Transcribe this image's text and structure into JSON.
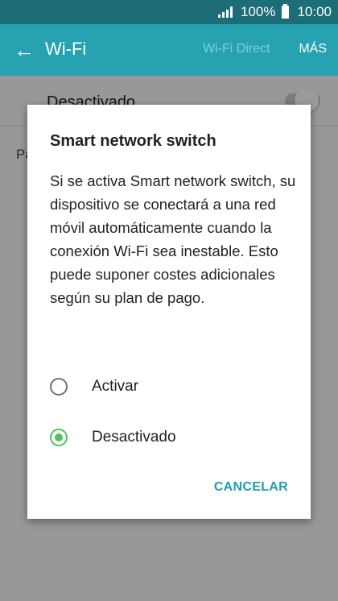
{
  "status_bar": {
    "battery_percent": "100%",
    "time": "10:00"
  },
  "app_bar": {
    "title": "Wi-Fi",
    "wifi_direct_label": "Wi-Fi Direct",
    "more_label": "MÁS"
  },
  "background_list": {
    "toggle_label": "Desactivado",
    "toggle_state": "off",
    "partial_text": "Pa"
  },
  "dialog": {
    "title": "Smart network switch",
    "message": "Si se activa Smart network switch, su dispositivo se conectará a una red móvil automáticamente cuando la conexión Wi-Fi sea inestable. Esto puede suponer costes adicionales según su plan de pago.",
    "options": [
      {
        "label": "Activar",
        "selected": false
      },
      {
        "label": "Desactivado",
        "selected": true
      }
    ],
    "cancel_label": "CANCELAR"
  },
  "colors": {
    "status_bar": "#1c6d77",
    "app_bar": "#27a2b0",
    "radio_selected": "#4fc45a",
    "cancel_button": "#1f9db0"
  },
  "icons": {
    "back": "arrow-left-icon",
    "signal": "signal-strength-icon",
    "battery": "battery-icon"
  }
}
